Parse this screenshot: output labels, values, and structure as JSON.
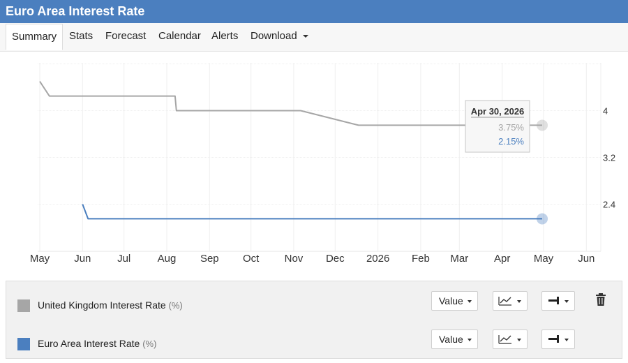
{
  "page": {
    "title": "Euro Area Interest Rate"
  },
  "tabs": [
    {
      "label": "Summary",
      "active": true
    },
    {
      "label": "Stats"
    },
    {
      "label": "Forecast"
    },
    {
      "label": "Calendar"
    },
    {
      "label": "Alerts"
    },
    {
      "label": "Download",
      "dropdown": true
    }
  ],
  "tooltip": {
    "date": "Apr 30, 2026",
    "values": [
      "3.75%",
      "2.15%"
    ]
  },
  "legend": [
    {
      "name": "United Kingdom Interest Rate",
      "unit": "(%)",
      "color": "#a6a6a6",
      "value_select": "Value"
    },
    {
      "name": "Euro Area Interest Rate",
      "unit": "(%)",
      "color": "#4b7fbf",
      "value_select": "Value"
    }
  ],
  "icons": {
    "chart_type": "line-chart-icon",
    "axis_side": "axis-side-icon",
    "delete": "trash-icon"
  },
  "chart_data": {
    "type": "line",
    "x_ticks": [
      "May",
      "Jun",
      "Jul",
      "Aug",
      "Sep",
      "Oct",
      "Nov",
      "Dec",
      "2026",
      "Feb",
      "Mar",
      "Apr",
      "May",
      "Jun"
    ],
    "x_tick_dates": [
      "2025-05-01",
      "2025-06-01",
      "2025-07-01",
      "2025-08-01",
      "2025-09-01",
      "2025-10-01",
      "2025-11-01",
      "2025-12-01",
      "2026-01-01",
      "2026-02-01",
      "2026-03-01",
      "2026-04-01",
      "2026-05-01",
      "2026-06-01"
    ],
    "y_ticks": [
      "2.4",
      "3.2",
      "4"
    ],
    "y_tick_values": [
      2.4,
      3.2,
      4.0
    ],
    "y_axis_position": "right",
    "series": [
      {
        "name": "United Kingdom Interest Rate",
        "color": "#a6a6a6",
        "points": [
          [
            "2025-05-01",
            4.5
          ],
          [
            "2025-05-08",
            4.25
          ],
          [
            "2025-08-07",
            4.25
          ],
          [
            "2025-08-08",
            4.0
          ],
          [
            "2025-11-06",
            4.0
          ],
          [
            "2025-12-18",
            3.75
          ],
          [
            "2026-04-30",
            3.75
          ]
        ]
      },
      {
        "name": "Euro Area Interest Rate",
        "color": "#4b7fbf",
        "points": [
          [
            "2025-06-01",
            2.4
          ],
          [
            "2025-06-05",
            2.15
          ],
          [
            "2026-04-30",
            2.15
          ]
        ]
      }
    ],
    "grid": true,
    "legend_placement": "bottom"
  }
}
